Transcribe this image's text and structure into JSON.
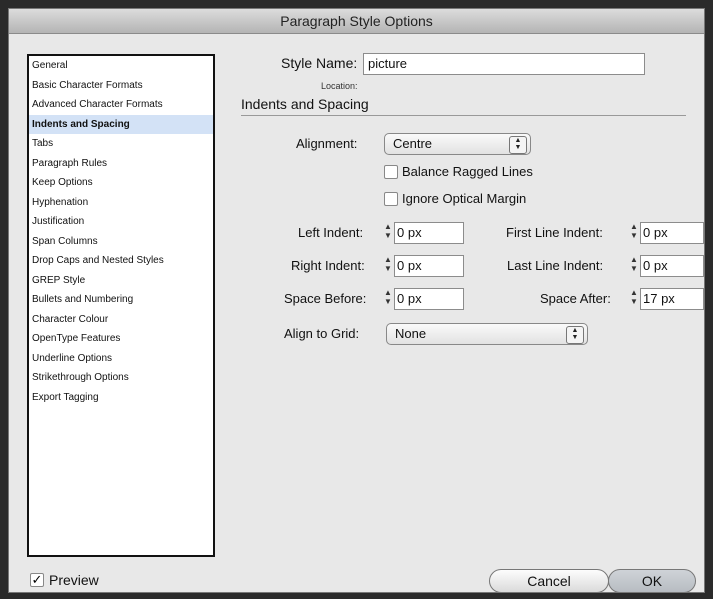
{
  "window": {
    "title": "Paragraph Style Options"
  },
  "sidebar": {
    "items": [
      {
        "label": "General"
      },
      {
        "label": "Basic Character Formats"
      },
      {
        "label": "Advanced Character Formats"
      },
      {
        "label": "Indents and Spacing",
        "selected": true
      },
      {
        "label": "Tabs"
      },
      {
        "label": "Paragraph Rules"
      },
      {
        "label": "Keep Options"
      },
      {
        "label": "Hyphenation"
      },
      {
        "label": "Justification"
      },
      {
        "label": "Span Columns"
      },
      {
        "label": "Drop Caps and Nested Styles"
      },
      {
        "label": "GREP Style"
      },
      {
        "label": "Bullets and Numbering"
      },
      {
        "label": "Character Colour"
      },
      {
        "label": "OpenType Features"
      },
      {
        "label": "Underline Options"
      },
      {
        "label": "Strikethrough Options"
      },
      {
        "label": "Export Tagging"
      }
    ]
  },
  "style_name": {
    "label": "Style Name:",
    "value": "picture"
  },
  "location": {
    "label": "Location:"
  },
  "section": {
    "title": "Indents and Spacing"
  },
  "alignment": {
    "label": "Alignment:",
    "value": "Centre"
  },
  "checkboxes": {
    "balance": {
      "label": "Balance Ragged Lines",
      "checked": false
    },
    "optical": {
      "label": "Ignore Optical Margin",
      "checked": false
    }
  },
  "fields": {
    "left_indent": {
      "label": "Left Indent:",
      "value": "0 px"
    },
    "right_indent": {
      "label": "Right Indent:",
      "value": "0 px"
    },
    "space_before": {
      "label": "Space Before:",
      "value": "0 px"
    },
    "first_line": {
      "label": "First Line Indent:",
      "value": "0 px"
    },
    "last_line": {
      "label": "Last Line Indent:",
      "value": "0 px"
    },
    "space_after": {
      "label": "Space After:",
      "value": "17 px"
    }
  },
  "grid": {
    "label": "Align to Grid:",
    "value": "None"
  },
  "preview": {
    "label": "Preview",
    "checked": true,
    "mark": "✓"
  },
  "buttons": {
    "cancel": "Cancel",
    "ok": "OK"
  },
  "glyphs": {
    "up": "▲",
    "down": "▼"
  },
  "colors": {
    "selection": "#d3e2f6",
    "window": "#e8e8e8"
  }
}
